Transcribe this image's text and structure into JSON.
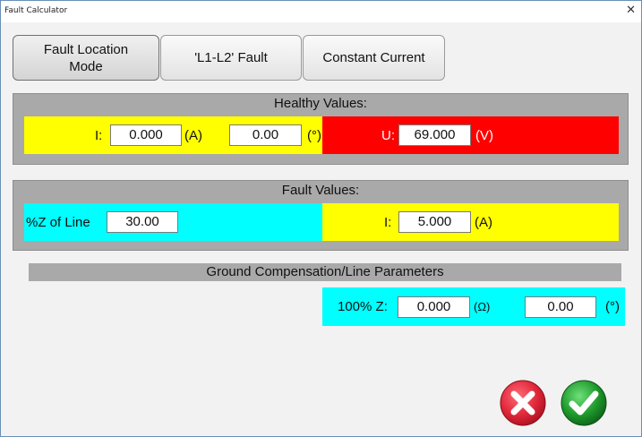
{
  "window": {
    "title": "Fault Calculator",
    "close_glyph": "✕"
  },
  "tabs": [
    {
      "label_line1": "Fault Location",
      "label_line2": "Mode"
    },
    {
      "label": "'L1-L2' Fault"
    },
    {
      "label": "Constant Current"
    }
  ],
  "healthy": {
    "header": "Healthy Values:",
    "current_label": "I:",
    "current_value": "0.000",
    "current_unit": "(A)",
    "angle_value": "0.00",
    "angle_unit": "(°)",
    "voltage_label": "U:",
    "voltage_value": "69.000",
    "voltage_unit": "(V)"
  },
  "fault": {
    "header": "Fault Values:",
    "z_label": "%Z of Line",
    "z_value": "30.00",
    "current_label": "I:",
    "current_value": "5.000",
    "current_unit": "(A)"
  },
  "ground": {
    "header": "Ground Compensation/Line Parameters",
    "z_label": "100% Z:",
    "z_value": "0.000",
    "z_unit": "(Ω)",
    "angle_value": "0.00",
    "angle_unit": "(°)"
  },
  "colors": {
    "yellow": "#ffff00",
    "red": "#ff0000",
    "cyan": "#00ffff",
    "panel_gray": "#a9a9a9",
    "cancel": "#e0283a",
    "ok": "#1e9a2c"
  },
  "icons": {
    "cancel": "cancel-icon",
    "ok": "checkmark-icon"
  }
}
